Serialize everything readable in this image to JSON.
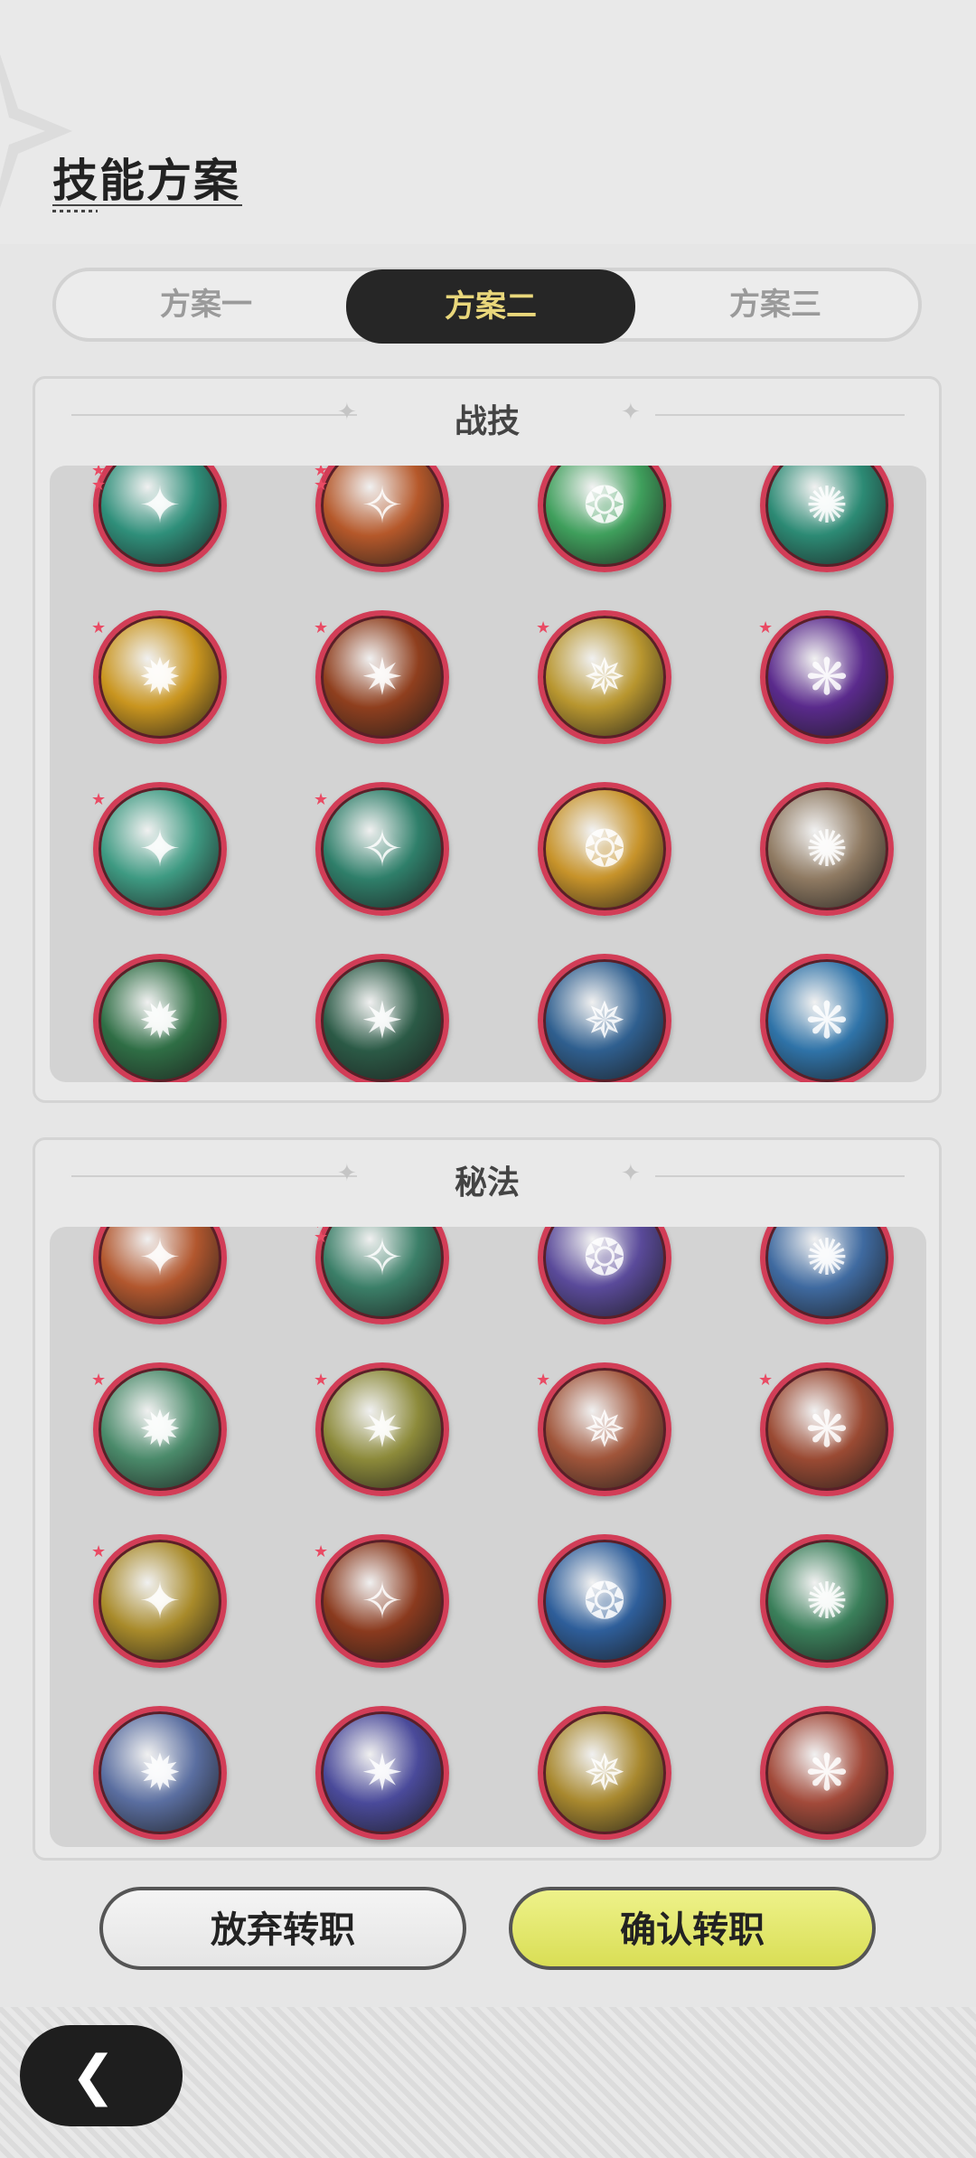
{
  "page": {
    "title": "技能方案"
  },
  "tabs": [
    {
      "label": "方案一",
      "active": false
    },
    {
      "label": "方案二",
      "active": true
    },
    {
      "label": "方案三",
      "active": false
    }
  ],
  "sections": {
    "combat": {
      "title": "战技",
      "skills": [
        {
          "icon": "green-wind-swirl-icon",
          "color": "#2f8f7a",
          "marks": 3
        },
        {
          "icon": "fire-vortex-icon",
          "color": "#b5582a",
          "marks": 3
        },
        {
          "icon": "green-flame-icon",
          "color": "#3f9f5c",
          "marks": 1
        },
        {
          "icon": "wind-sphere-icon",
          "color": "#2c8a74",
          "marks": 1
        },
        {
          "icon": "golden-spikes-icon",
          "color": "#c9951f",
          "marks": 1
        },
        {
          "icon": "campfire-icon",
          "color": "#8f3f1e",
          "marks": 1
        },
        {
          "icon": "golden-burst-icon",
          "color": "#b8962f",
          "marks": 1
        },
        {
          "icon": "purple-crack-icon",
          "color": "#5a2a8c",
          "marks": 1
        },
        {
          "icon": "green-whirl-icon",
          "color": "#3e9a82",
          "marks": 1
        },
        {
          "icon": "green-arrow-arc-icon",
          "color": "#2f7f6a",
          "marks": 1
        },
        {
          "icon": "golden-star-strike-icon",
          "color": "#c7932a",
          "marks": 0
        },
        {
          "icon": "earth-shield-icon",
          "color": "#8f7a62",
          "marks": 0
        },
        {
          "icon": "green-plus-icon",
          "color": "#2f6e45",
          "marks": 0
        },
        {
          "icon": "thorn-ring-icon",
          "color": "#2b5a46",
          "marks": 0
        },
        {
          "icon": "ice-shard-icon",
          "color": "#2f5f8f",
          "marks": 0
        },
        {
          "icon": "water-vortex-icon",
          "color": "#2f73a8",
          "marks": 0
        }
      ]
    },
    "arcane": {
      "title": "秘法",
      "skills": [
        {
          "icon": "fire-orb-icon",
          "color": "#b2572e",
          "marks": 0
        },
        {
          "icon": "green-crystal-icon",
          "color": "#3b7f68",
          "marks": 3
        },
        {
          "icon": "purple-orbit-icon",
          "color": "#5a4a9a",
          "marks": 1
        },
        {
          "icon": "snow-figure-icon",
          "color": "#3f6aa0",
          "marks": 1
        },
        {
          "icon": "green-shield-icon",
          "color": "#4a8a6a",
          "marks": 1
        },
        {
          "icon": "heal-figure-icon",
          "color": "#8c8a3a",
          "marks": 1
        },
        {
          "icon": "flame-figure-icon",
          "color": "#a0553a",
          "marks": 1
        },
        {
          "icon": "demon-face-icon",
          "color": "#9a4a33",
          "marks": 1
        },
        {
          "icon": "lightning-bolt-icon",
          "color": "#a88a2a",
          "marks": 1
        },
        {
          "icon": "fire-spirit-icon",
          "color": "#8a3a1e",
          "marks": 1
        },
        {
          "icon": "blue-crystal-icon",
          "color": "#2e5e9a",
          "marks": 0
        },
        {
          "icon": "green-heart-icon",
          "color": "#3a7f5a",
          "marks": 0
        },
        {
          "icon": "blue-gem-icon",
          "color": "#5a6ea0",
          "marks": 0
        },
        {
          "icon": "star-wave-icon",
          "color": "#4a4a9a",
          "marks": 0
        },
        {
          "icon": "gold-shatter-icon",
          "color": "#a8882e",
          "marks": 0
        },
        {
          "icon": "red-figure-icon",
          "color": "#a24a3a",
          "marks": 0
        }
      ]
    }
  },
  "buttons": {
    "abandon": "放弃转职",
    "confirm": "确认转职"
  },
  "nav": {
    "back_icon": "chevron-left-icon"
  }
}
